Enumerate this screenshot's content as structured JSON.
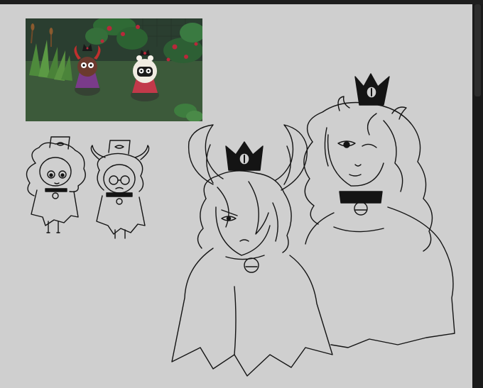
{
  "canvas": {
    "background_color": "#cfcfcf",
    "frame_color": "#1e1e1e",
    "line_color": "#141414"
  },
  "reference_image": {
    "subjects": [
      "demon-character",
      "lamb-character"
    ],
    "palette": {
      "ground": "#3c5a3a",
      "foliage": "#2f6a35",
      "roses": "#b8283a",
      "cloak_purple": "#7a3b8a",
      "cloak_red": "#c2394a",
      "fleece": "#f0ece2"
    }
  },
  "sketches": {
    "chibi_count": 2,
    "bust_count": 2
  },
  "scrollbar": {
    "orientation": "vertical"
  }
}
